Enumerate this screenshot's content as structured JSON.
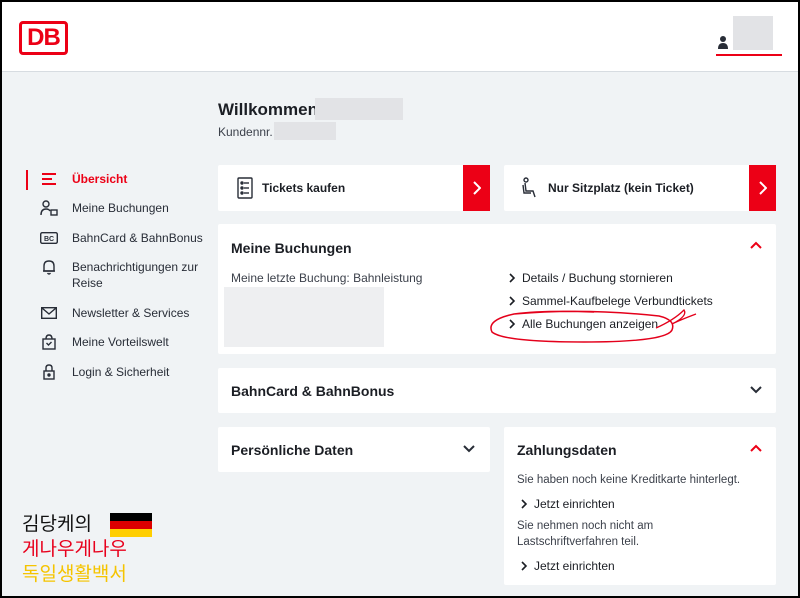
{
  "header": {
    "logo_text": "DB",
    "brand_color": "#ec0016"
  },
  "welcome": {
    "greeting": "Willkommen,",
    "customer_label": "Kundennr."
  },
  "nav": {
    "items": [
      {
        "label": "Übersicht",
        "icon": "menu-icon",
        "active": true
      },
      {
        "label": "Meine Buchungen",
        "icon": "person-bookings-icon"
      },
      {
        "label": "BahnCard & BahnBonus",
        "icon": "bahncard-icon"
      },
      {
        "label": "Benachrichtigungen zur Reise",
        "icon": "bell-icon"
      },
      {
        "label": "Newsletter & Services",
        "icon": "mail-icon"
      },
      {
        "label": "Meine Vorteilswelt",
        "icon": "shopping-bag-icon"
      },
      {
        "label": "Login & Sicherheit",
        "icon": "lock-icon"
      }
    ]
  },
  "quick_actions": {
    "tickets": "Tickets kaufen",
    "seat": "Nur Sitzplatz (kein Ticket)"
  },
  "bookings": {
    "title": "Meine Buchungen",
    "last_booking": "Meine letzte Buchung: Bahnleistung",
    "links": [
      "Details / Buchung stornieren",
      "Sammel-Kaufbelege Verbundtickets",
      "Alle Buchungen anzeigen"
    ]
  },
  "bahncard": {
    "title": "BahnCard & BahnBonus"
  },
  "personal": {
    "title": "Persönliche Daten"
  },
  "payment": {
    "title": "Zahlungsdaten",
    "no_card": "Sie haben noch keine Kreditkarte hinterlegt.",
    "setup_1": "Jetzt einrichten",
    "no_debit_1": "Sie nehmen noch nicht am",
    "no_debit_2": "Lastschriftverfahren teil.",
    "setup_2": "Jetzt einrichten"
  },
  "watermark": {
    "line1": "김당케의",
    "line2": "게나우게나우",
    "line3": "독일생활백서"
  }
}
